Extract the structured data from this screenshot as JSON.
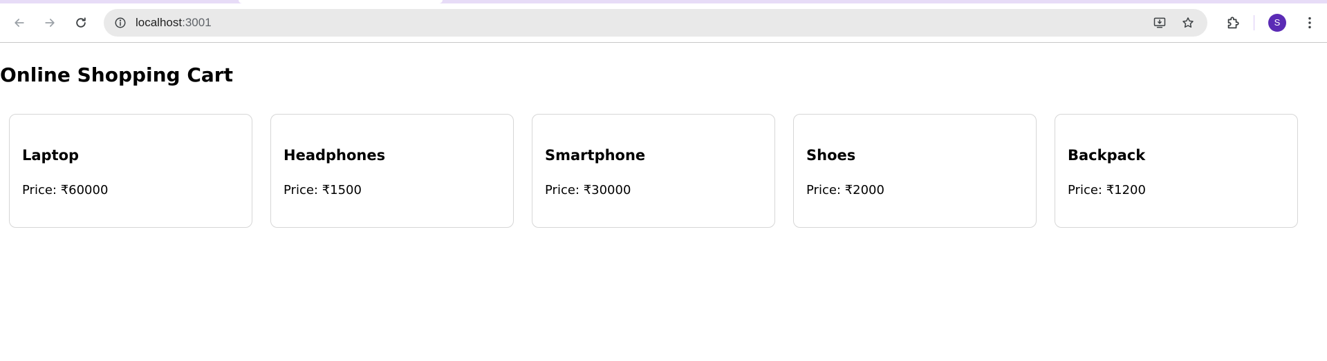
{
  "browser": {
    "url_host": "localhost",
    "url_port": ":3001",
    "profile_initial": "S",
    "icons": {
      "back": "arrow-left-icon",
      "forward": "arrow-right-icon",
      "reload": "reload-icon",
      "site_info": "info-icon",
      "install": "install-app-icon",
      "bookmark": "star-icon",
      "extensions": "puzzle-icon",
      "menu": "kebab-menu-icon"
    },
    "colors": {
      "avatar": "#5b2bb5",
      "tabstrip": "#e7dcf7"
    }
  },
  "page": {
    "title": "Online Shopping Cart"
  },
  "products": [
    {
      "name": "Laptop",
      "price": "Price: ₹60000"
    },
    {
      "name": "Headphones",
      "price": "Price: ₹1500"
    },
    {
      "name": "Smartphone",
      "price": "Price: ₹30000"
    },
    {
      "name": "Shoes",
      "price": "Price: ₹2000"
    },
    {
      "name": "Backpack",
      "price": "Price: ₹1200"
    }
  ]
}
